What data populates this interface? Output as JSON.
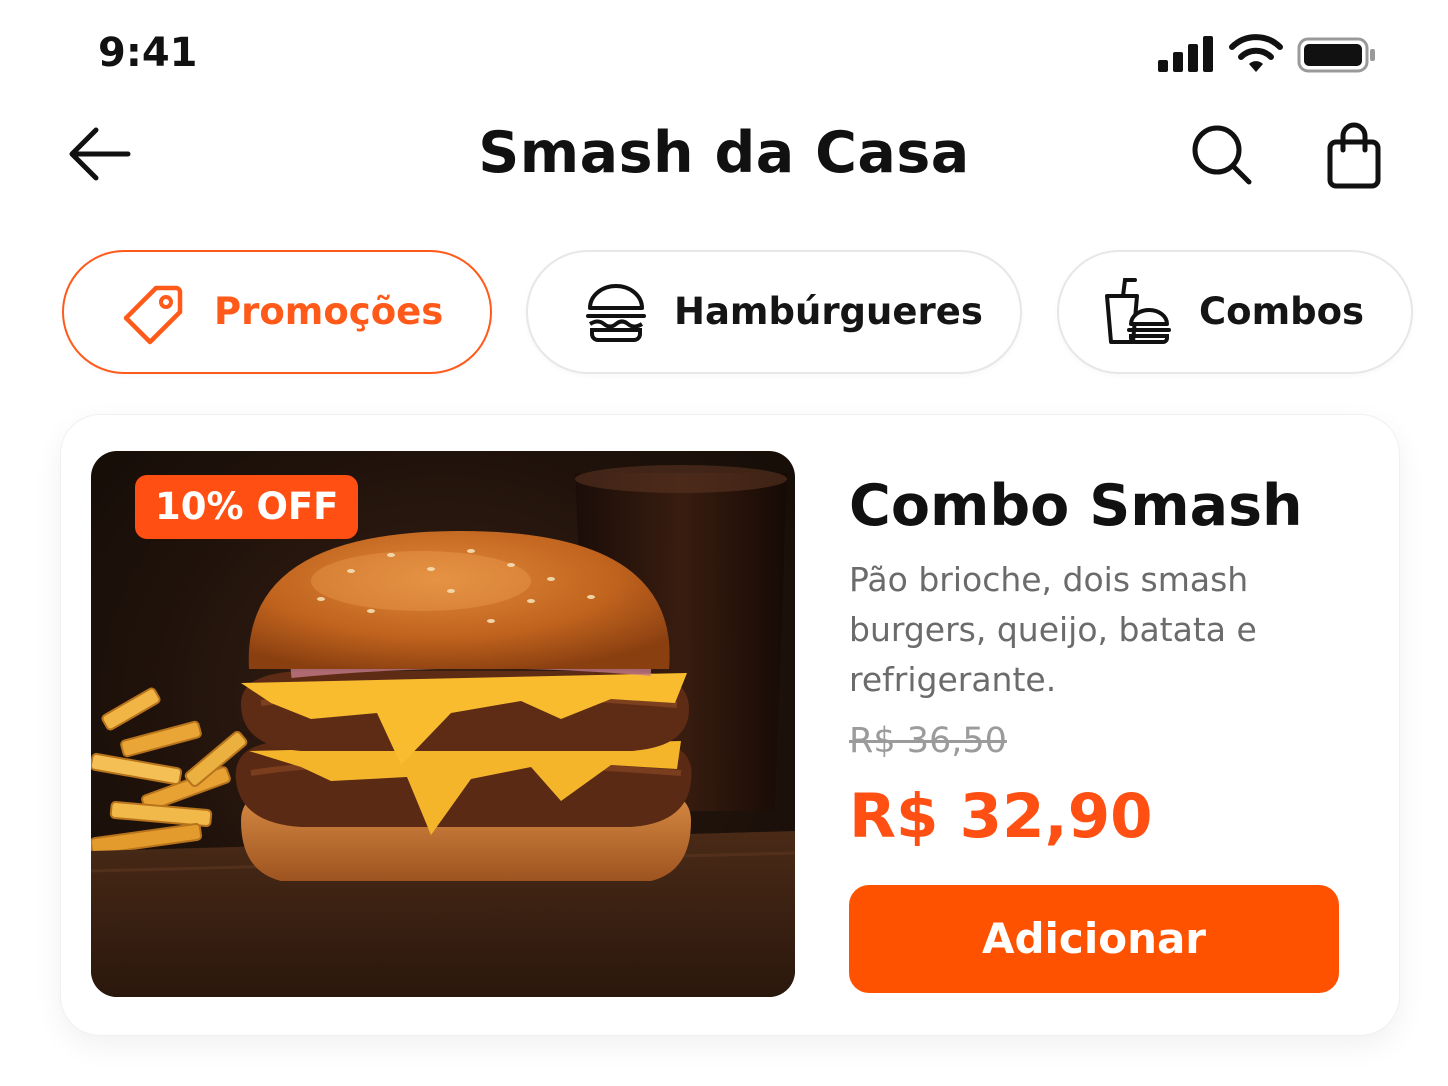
{
  "status_bar": {
    "time": "9:41",
    "icons": [
      "cellular-signal-icon",
      "wifi-icon",
      "battery-icon"
    ]
  },
  "header": {
    "title": "Smash da Casa",
    "back_icon": "arrow-left-icon",
    "search_icon": "search-icon",
    "bag_icon": "shopping-bag-icon"
  },
  "categories": [
    {
      "label": "Promoções",
      "icon": "tag-icon",
      "selected": true
    },
    {
      "label": "Hambúrgueres",
      "icon": "burger-icon",
      "selected": false
    },
    {
      "label": "Combos",
      "icon": "drink-burger-icon",
      "selected": false
    }
  ],
  "product": {
    "badge": "10% OFF",
    "title": "Combo Smash",
    "description": "Pão brioche, dois smash burgers, queijo, batata e refrigerante.",
    "old_price": "R$ 36,50",
    "new_price": "R$ 32,90",
    "add_label": "Adicionar"
  },
  "colors": {
    "accent": "#ff5200",
    "text": "#111111",
    "muted": "#6b6b6b"
  }
}
